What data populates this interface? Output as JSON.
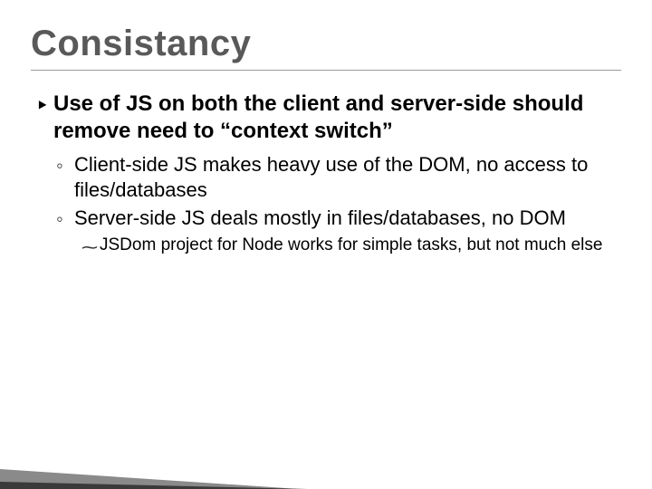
{
  "title": "Consistancy",
  "bullets": {
    "level1": {
      "marker": "‣",
      "text": "Use of JS on both the client and server-side should remove need to “context switch”"
    },
    "level2a": {
      "marker": "◦",
      "text": "Client-side JS makes heavy use of the DOM, no access to files/databases"
    },
    "level2b": {
      "marker": "◦",
      "text": "Server-side JS deals mostly in files/databases, no DOM"
    },
    "level3": {
      "marker": "⁓",
      "text": "JSDom project for Node works for simple tasks, but not much else"
    }
  }
}
